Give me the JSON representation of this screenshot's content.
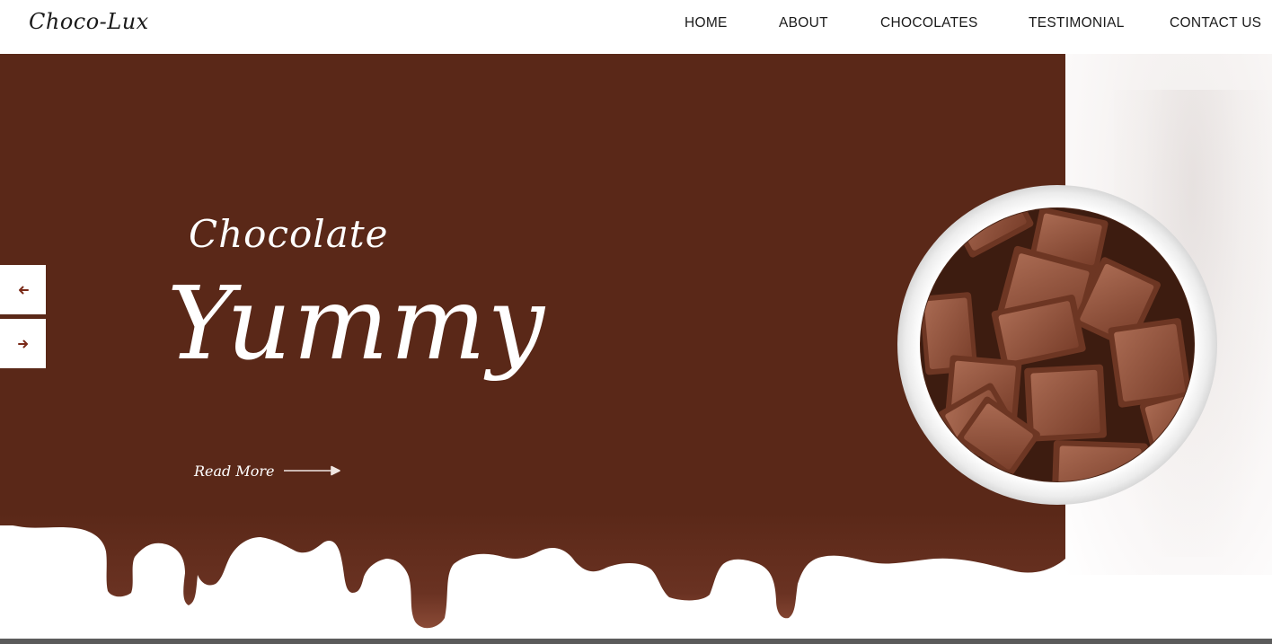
{
  "brand": {
    "logo_text": "Choco-Lux"
  },
  "nav": {
    "items": [
      {
        "label": "HOME"
      },
      {
        "label": "ABOUT"
      },
      {
        "label": "CHOCOLATES"
      },
      {
        "label": "TESTIMONIAL"
      },
      {
        "label": "CONTACT US"
      }
    ]
  },
  "hero": {
    "title_small": "Chocolate",
    "title_big": "Yummy",
    "read_more_label": "Read More",
    "image": {
      "icon": "chocolate-bowl-image"
    }
  },
  "slider": {
    "prev_icon": "arrow-left-icon",
    "next_icon": "arrow-right-icon"
  },
  "colors": {
    "brand_brown": "#5a2818",
    "chocolate": "#7a3f2b",
    "white": "#ffffff",
    "text_dark": "#1a1a1a"
  }
}
